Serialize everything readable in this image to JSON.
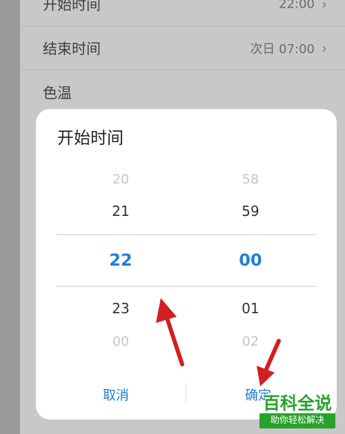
{
  "settings": {
    "start_time": {
      "label": "开始时间",
      "value": "22:00"
    },
    "end_time": {
      "label": "结束时间",
      "value": "次日 07:00"
    },
    "color_temp": {
      "label": "色温"
    }
  },
  "dialog": {
    "title": "开始时间",
    "hours": [
      "20",
      "21",
      "22",
      "23",
      "00"
    ],
    "minutes": [
      "58",
      "59",
      "00",
      "01",
      "02"
    ],
    "selected_hour": "22",
    "selected_minute": "00",
    "cancel_label": "取消",
    "confirm_label": "确定"
  },
  "watermark": {
    "brand": "百科全说",
    "slogan": "助你轻松解决"
  },
  "colors": {
    "accent": "#1e7fd8",
    "arrow": "#d21f1f",
    "watermark": "#2aa12c"
  }
}
